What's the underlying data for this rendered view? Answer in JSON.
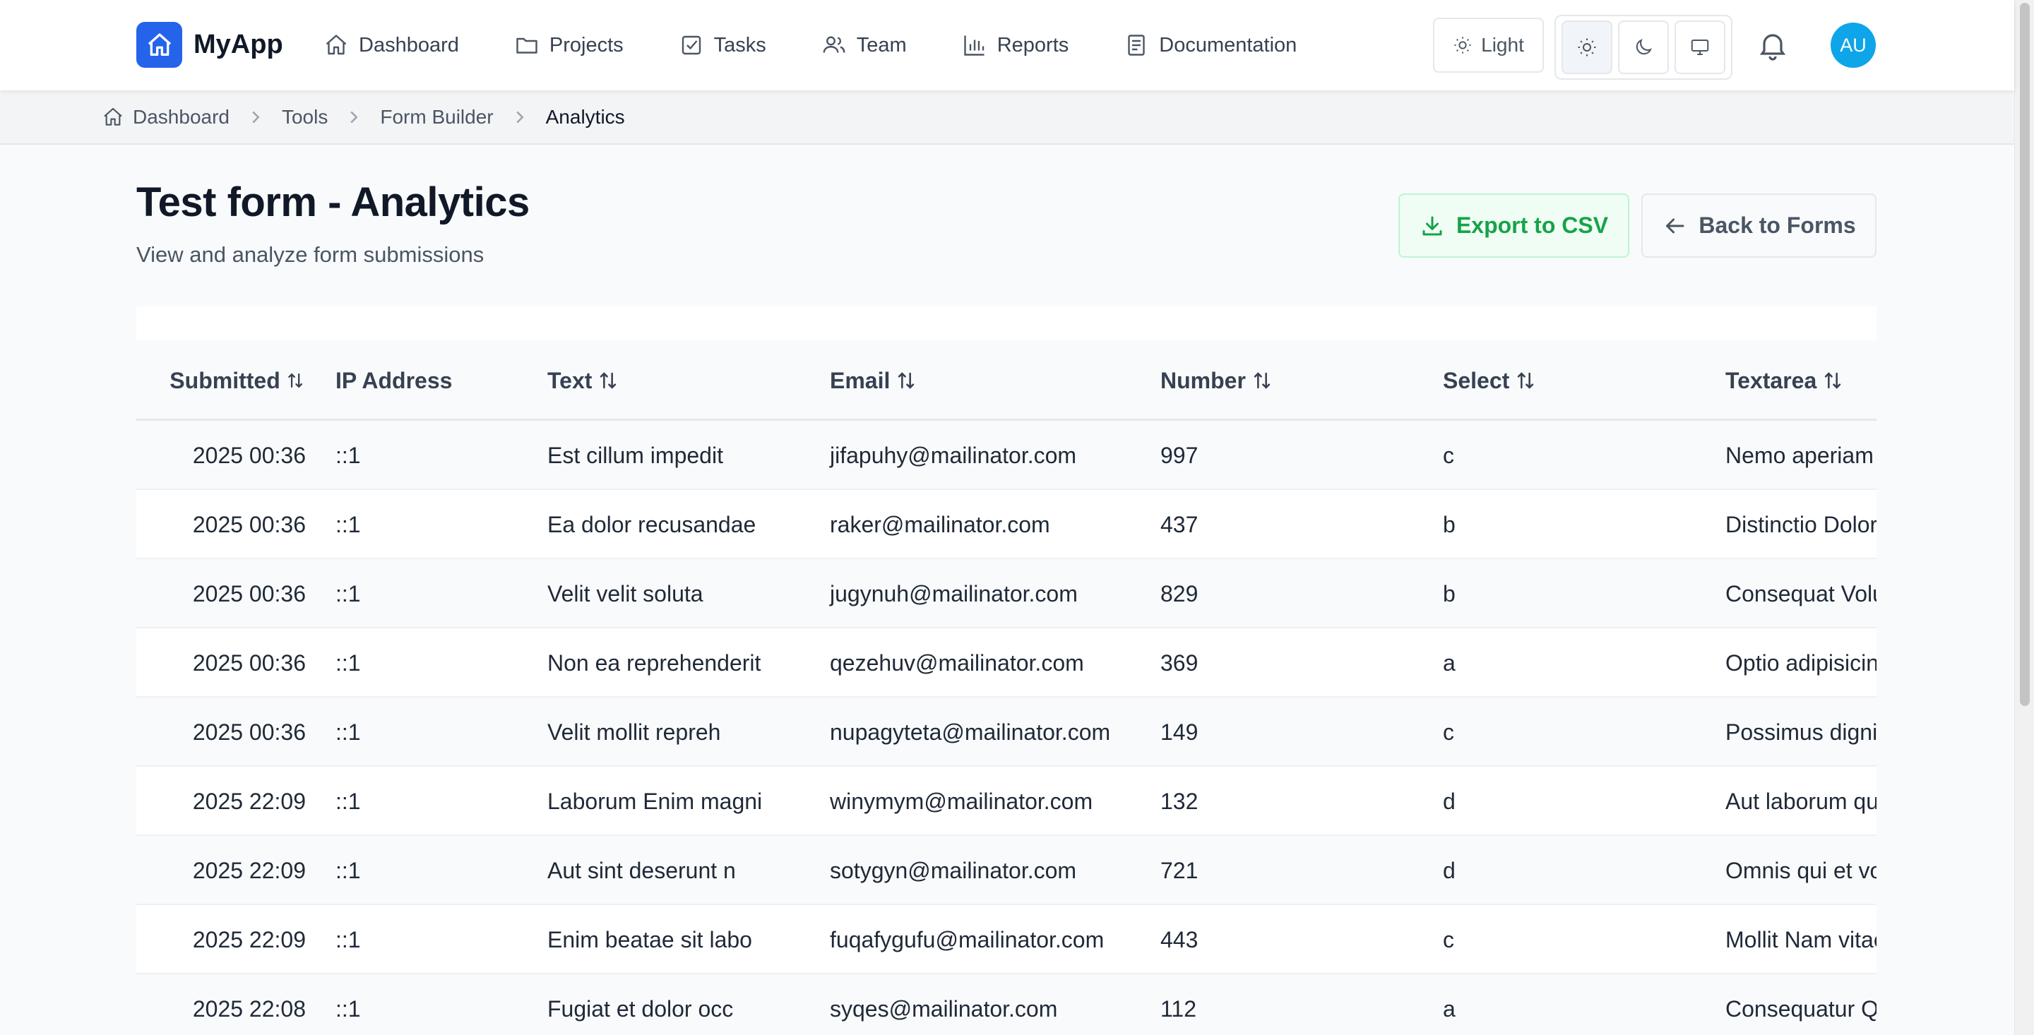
{
  "app": {
    "name": "MyApp"
  },
  "nav": {
    "links": [
      {
        "label": "Dashboard",
        "icon": "home-icon"
      },
      {
        "label": "Projects",
        "icon": "folder-icon"
      },
      {
        "label": "Tasks",
        "icon": "checkbox-icon"
      },
      {
        "label": "Team",
        "icon": "users-icon"
      },
      {
        "label": "Reports",
        "icon": "bar-chart-icon"
      },
      {
        "label": "Documentation",
        "icon": "document-icon"
      }
    ],
    "theme_button_label": "Light",
    "theme_options": [
      "sun-icon",
      "moon-icon",
      "monitor-icon"
    ],
    "avatar_initials": "AU"
  },
  "breadcrumb": [
    "Dashboard",
    "Tools",
    "Form Builder",
    "Analytics"
  ],
  "header": {
    "title": "Test form - Analytics",
    "subtitle": "View and analyze form submissions",
    "export_label": "Export to CSV",
    "back_label": "Back to Forms"
  },
  "table": {
    "columns": [
      "Submitted",
      "IP Address",
      "Text",
      "Email",
      "Number",
      "Select",
      "Textarea"
    ],
    "rows": [
      [
        "2025 00:36",
        "::1",
        "Est cillum impedit",
        "jifapuhy@mailinator.com",
        "997",
        "c",
        "Nemo aperiam p"
      ],
      [
        "2025 00:36",
        "::1",
        "Ea dolor recusandae",
        "raker@mailinator.com",
        "437",
        "b",
        "Distinctio Doloru"
      ],
      [
        "2025 00:36",
        "::1",
        "Velit velit soluta",
        "jugynuh@mailinator.com",
        "829",
        "b",
        "Consequat Volup"
      ],
      [
        "2025 00:36",
        "::1",
        "Non ea reprehenderit",
        "qezehuv@mailinator.com",
        "369",
        "a",
        "Optio adipisicing"
      ],
      [
        "2025 00:36",
        "::1",
        "Velit mollit repreh",
        "nupagyteta@mailinator.com",
        "149",
        "c",
        "Possimus digniss"
      ],
      [
        "2025 22:09",
        "::1",
        "Laborum Enim magni",
        "winymym@mailinator.com",
        "132",
        "d",
        "Aut laborum quis"
      ],
      [
        "2025 22:09",
        "::1",
        "Aut sint deserunt n",
        "sotygyn@mailinator.com",
        "721",
        "d",
        "Omnis qui et volu"
      ],
      [
        "2025 22:09",
        "::1",
        "Enim beatae sit labo",
        "fuqafygufu@mailinator.com",
        "443",
        "c",
        "Mollit Nam vitae"
      ],
      [
        "2025 22:08",
        "::1",
        "Fugiat et dolor occ",
        "syqes@mailinator.com",
        "112",
        "a",
        "Consequatur Qu"
      ]
    ]
  },
  "colors": {
    "brand": "#2563eb",
    "export_green": "#16a34a",
    "avatar": "#0ea5e9"
  }
}
